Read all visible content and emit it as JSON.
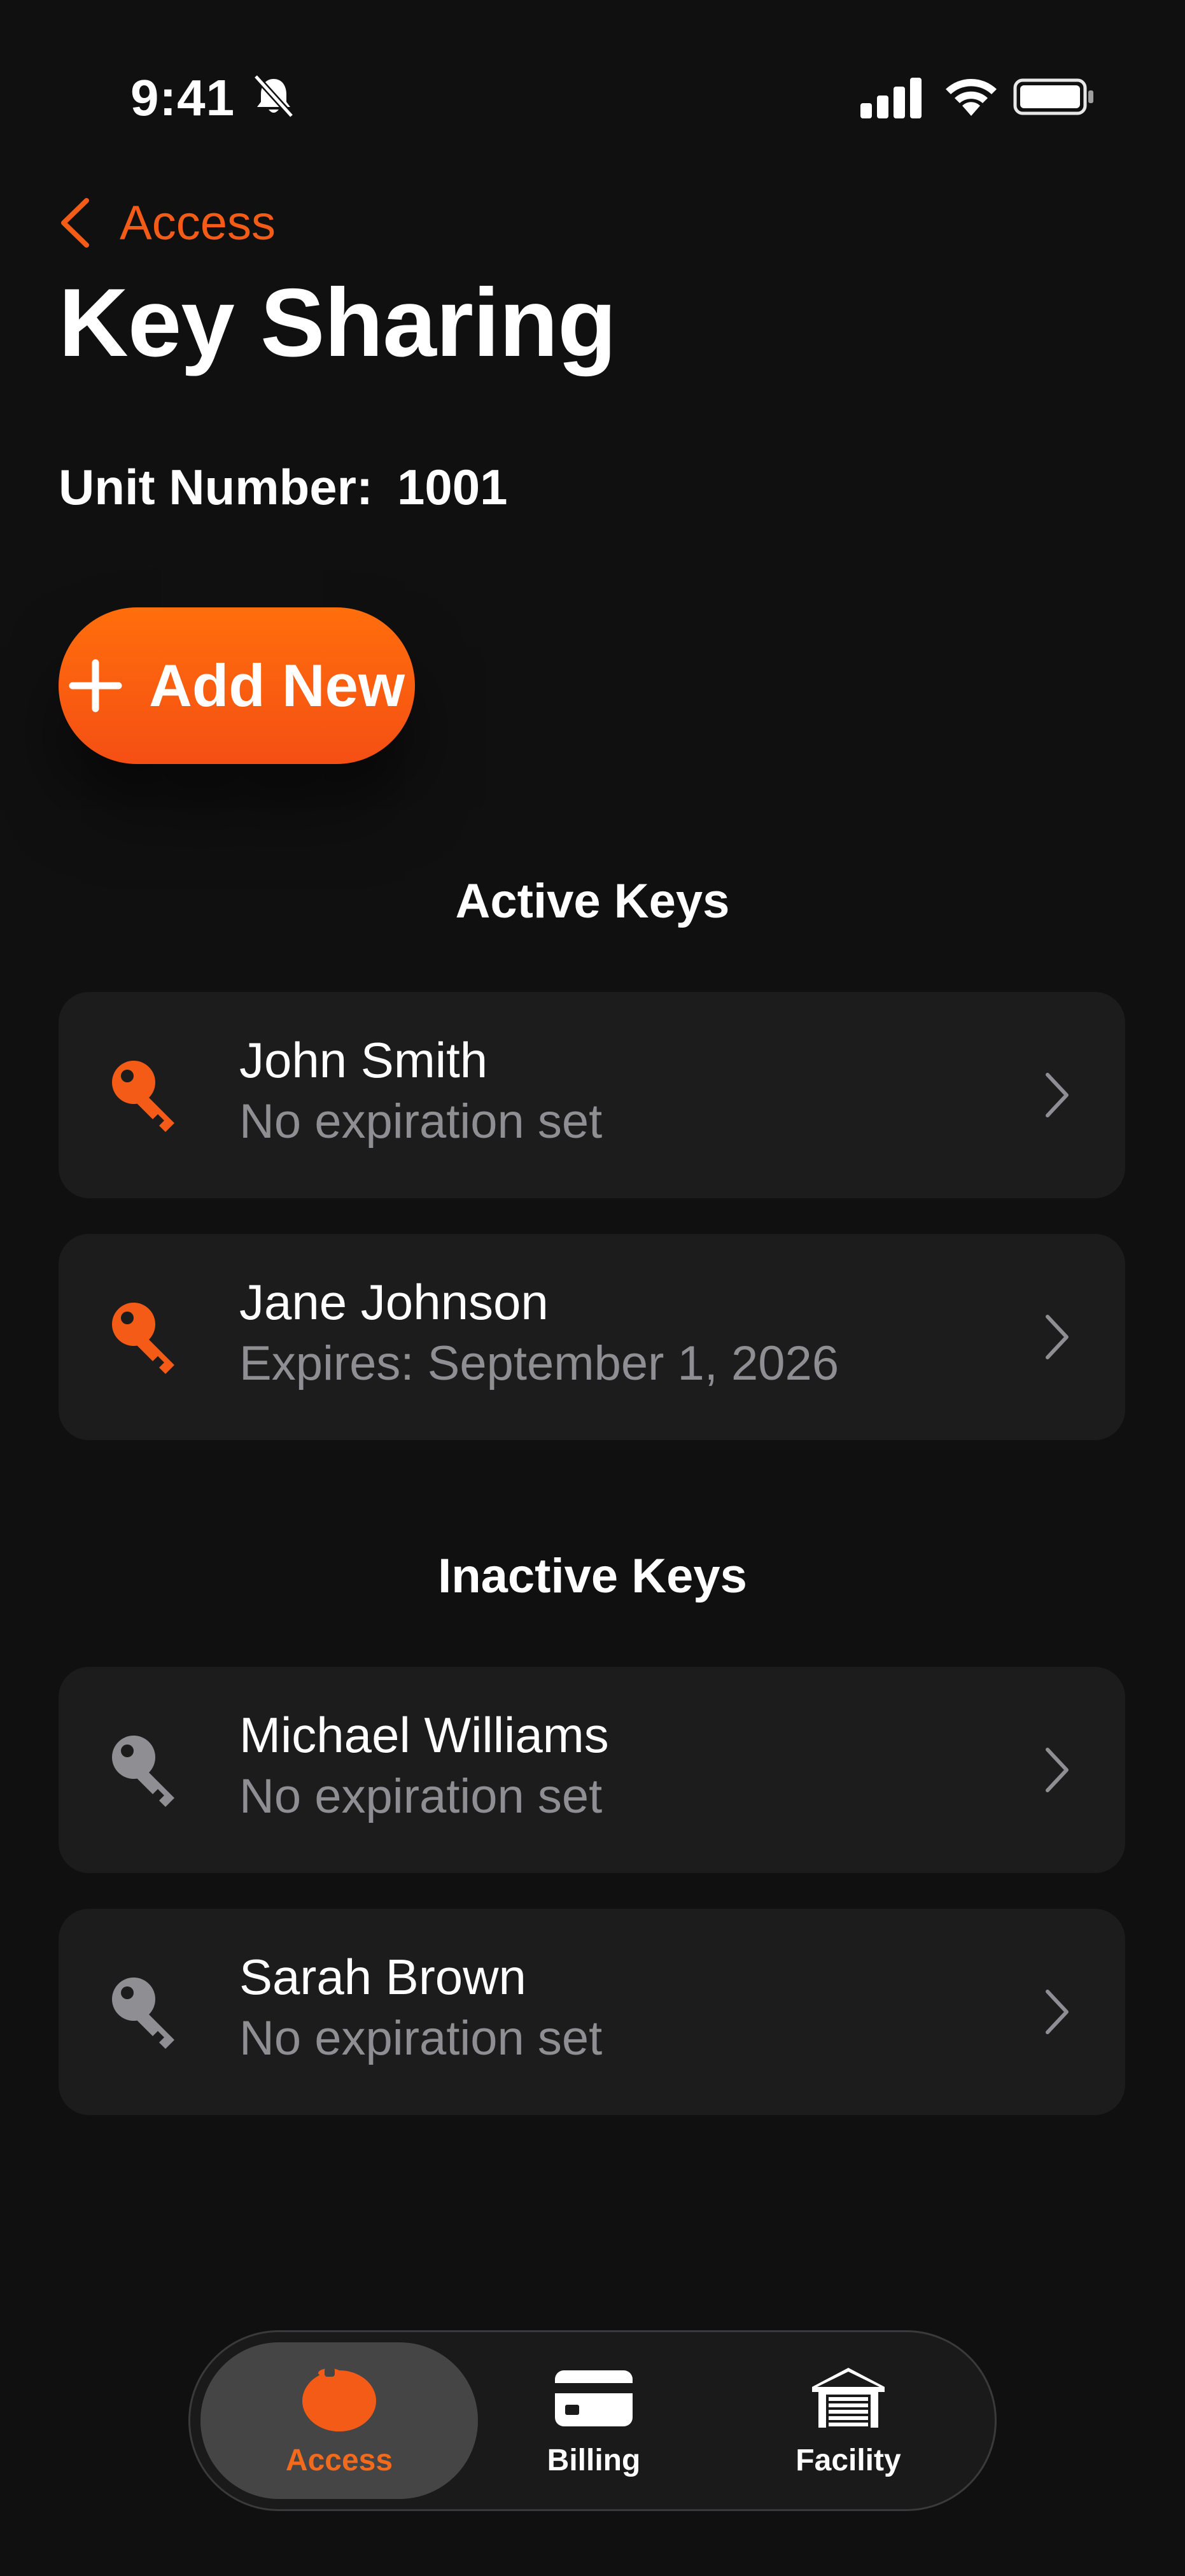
{
  "status_bar": {
    "time": "9:41"
  },
  "nav": {
    "back_label": "Access",
    "title": "Key Sharing"
  },
  "unit": {
    "label": "Unit Number:",
    "value": "1001"
  },
  "add_button": {
    "label": "Add New"
  },
  "sections": {
    "active_title": "Active Keys",
    "inactive_title": "Inactive Keys"
  },
  "active_keys": [
    {
      "name": "John Smith",
      "subtitle": "No expiration set"
    },
    {
      "name": "Jane Johnson",
      "subtitle": "Expires: September 1, 2026"
    }
  ],
  "inactive_keys": [
    {
      "name": "Michael Williams",
      "subtitle": "No expiration set"
    },
    {
      "name": "Sarah Brown",
      "subtitle": "No expiration set"
    }
  ],
  "tab_bar": {
    "tabs": [
      {
        "label": "Access",
        "icon": "access-fob-icon",
        "active": true
      },
      {
        "label": "Billing",
        "icon": "credit-card-icon",
        "active": false
      },
      {
        "label": "Facility",
        "icon": "storage-facility-icon",
        "active": false
      }
    ]
  },
  "colors": {
    "accent": "#F45B17",
    "background": "#101010",
    "card": "#1C1C1D",
    "secondary_text": "#8E8E93",
    "inactive_icon": "#8E8E93"
  }
}
